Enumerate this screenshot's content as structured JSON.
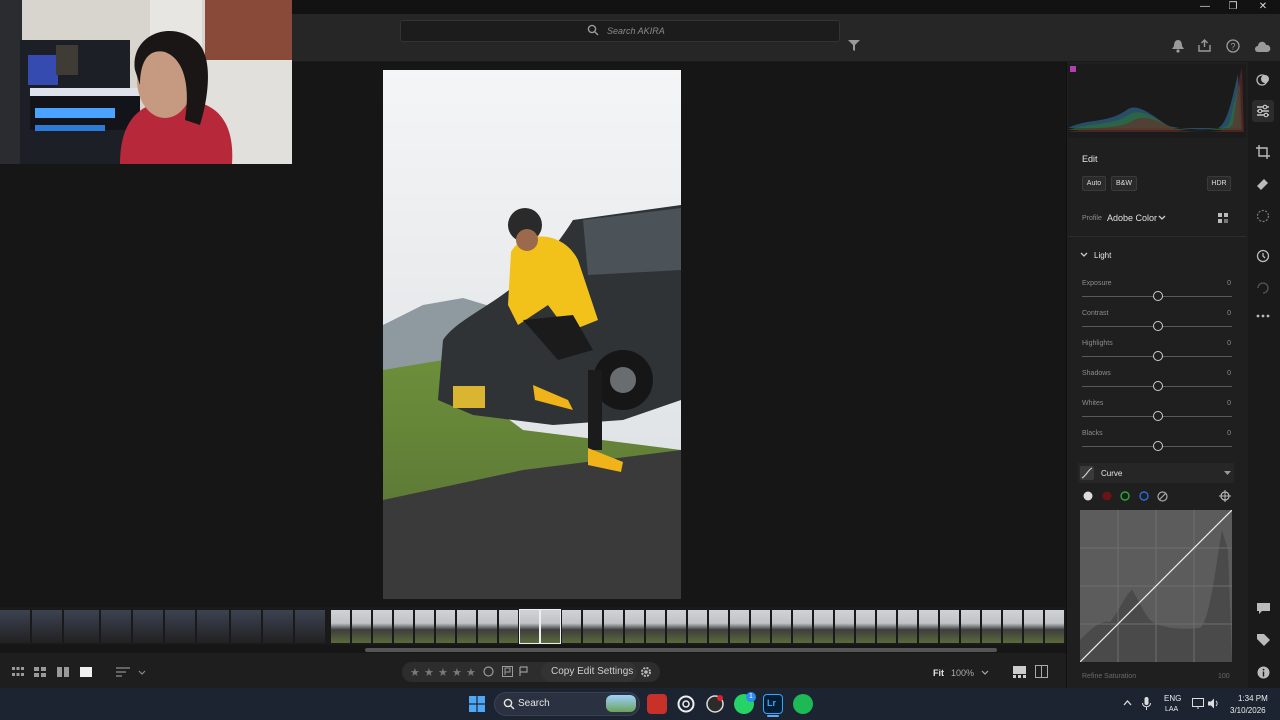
{
  "titlebar": {
    "minimize": "—",
    "restore": "❐",
    "close": "✕"
  },
  "search": {
    "placeholder": "Search AKIRA"
  },
  "edit": {
    "title": "Edit",
    "auto_label": "Auto",
    "bw_label": "B&W",
    "hdr_label": "HDR",
    "profile_label": "Profile",
    "profile_value": "Adobe Color"
  },
  "light": {
    "title": "Light",
    "sliders": [
      {
        "label": "Exposure",
        "value": "0"
      },
      {
        "label": "Contrast",
        "value": "0"
      },
      {
        "label": "Highlights",
        "value": "0"
      },
      {
        "label": "Shadows",
        "value": "0"
      },
      {
        "label": "Whites",
        "value": "0"
      },
      {
        "label": "Blacks",
        "value": "0"
      }
    ]
  },
  "curve": {
    "title": "Curve",
    "footer": "Refine Saturation",
    "footer_value": "100"
  },
  "bottombar": {
    "copy_label": "Copy Edit Settings",
    "fit_label": "Fit",
    "zoom_value": "100%"
  },
  "taskbar": {
    "search_label": "Search",
    "lang_top": "ENG",
    "lang_bottom": "LAA",
    "time": "1:34 PM",
    "date": "3/10/2026",
    "whatsapp_badge": "1"
  },
  "colors": {
    "accent": "#1473e6",
    "panel": "#1f1f1f",
    "canvas": "#161616"
  }
}
